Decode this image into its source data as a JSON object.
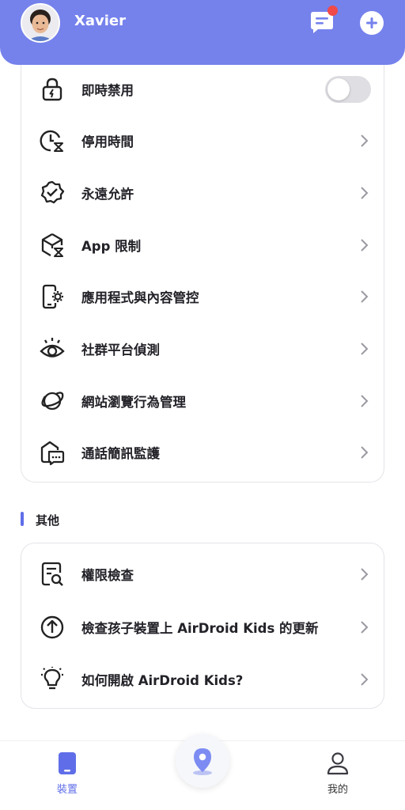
{
  "header": {
    "user_name": "Xavier",
    "icons": [
      "avatar",
      "message-icon",
      "add-icon"
    ],
    "colors": {
      "header_bg": "#7582ec",
      "notification_dot": "#f04a4a"
    }
  },
  "features": [
    {
      "label": "即時禁用",
      "icon": "lock-icon",
      "control": "toggle",
      "toggle_on": false
    },
    {
      "label": "停用時間",
      "icon": "clock-hourglass-icon",
      "control": "chevron"
    },
    {
      "label": "永遠允許",
      "icon": "verified-badge-icon",
      "control": "chevron"
    },
    {
      "label": "App 限制",
      "icon": "app-limit-icon",
      "control": "chevron"
    },
    {
      "label": "應用程式與內容管控",
      "icon": "device-gear-icon",
      "control": "chevron"
    },
    {
      "label": "社群平台偵測",
      "icon": "eye-icon",
      "control": "chevron"
    },
    {
      "label": "網站瀏覽行為管理",
      "icon": "planet-icon",
      "control": "chevron"
    },
    {
      "label": "通話簡訊監護",
      "icon": "chat-shield-icon",
      "control": "chevron"
    }
  ],
  "others": {
    "title": "其他",
    "items": [
      {
        "label": "權限檢查",
        "icon": "document-search-icon"
      },
      {
        "label": "檢查孩子裝置上 AirDroid Kids 的更新",
        "icon": "upload-circle-icon"
      },
      {
        "label": "如何開啟 AirDroid Kids?",
        "icon": "lightbulb-icon"
      }
    ]
  },
  "bottom_nav": {
    "devices_label": "裝置",
    "mine_label": "我的",
    "center_icon": "location-pin-icon",
    "active_color": "#5f6ee8"
  }
}
